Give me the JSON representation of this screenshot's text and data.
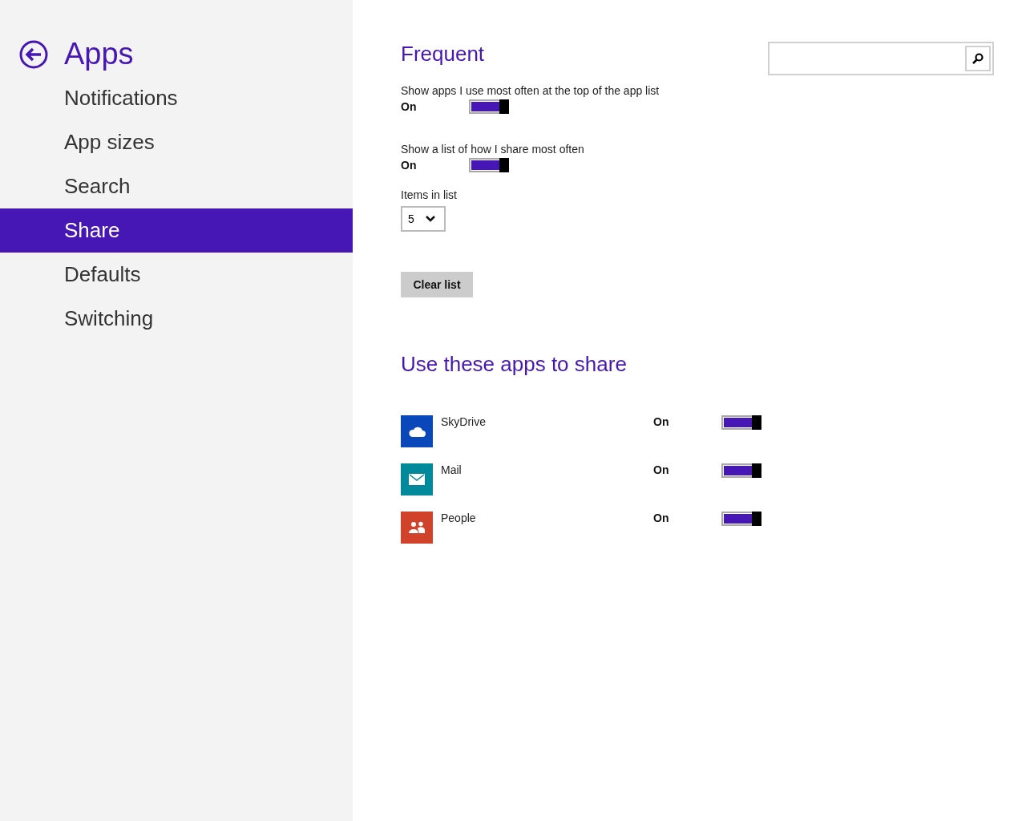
{
  "sidebar": {
    "title": "Apps",
    "items": [
      {
        "label": "Notifications",
        "selected": false
      },
      {
        "label": "App sizes",
        "selected": false
      },
      {
        "label": "Search",
        "selected": false
      },
      {
        "label": "Share",
        "selected": true
      },
      {
        "label": "Defaults",
        "selected": false
      },
      {
        "label": "Switching",
        "selected": false
      }
    ]
  },
  "frequent": {
    "heading": "Frequent",
    "settings": [
      {
        "label": "Show apps I use most often at the top of the app list",
        "state_text": "On",
        "on": true
      },
      {
        "label": "Show a list of how I share most often",
        "state_text": "On",
        "on": true
      }
    ],
    "items_in_list": {
      "label": "Items in list",
      "value": "5"
    },
    "clear_button": "Clear list"
  },
  "share_apps": {
    "heading": "Use these apps to share",
    "apps": [
      {
        "name": "SkyDrive",
        "kind": "cloud",
        "color": "#0a47b8",
        "state_text": "On",
        "on": true
      },
      {
        "name": "Mail",
        "kind": "mail",
        "color": "#00899a",
        "state_text": "On",
        "on": true
      },
      {
        "name": "People",
        "kind": "people",
        "color": "#d0432a",
        "state_text": "On",
        "on": true
      }
    ]
  }
}
